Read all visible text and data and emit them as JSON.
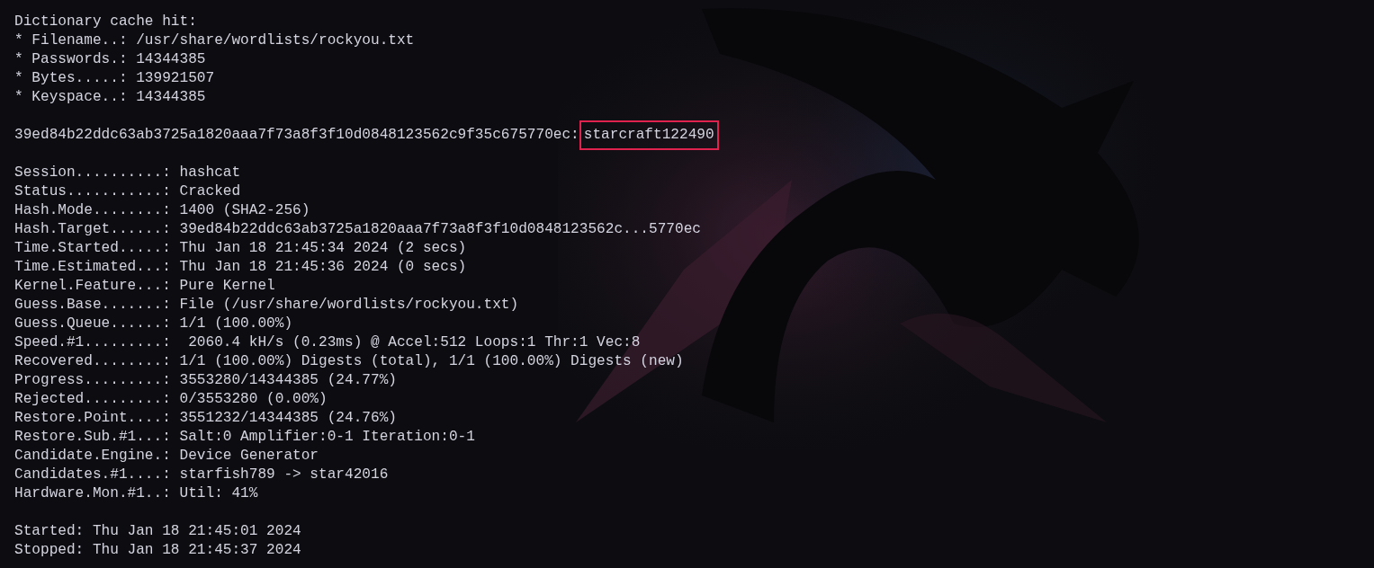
{
  "cache_info": [
    "Dictionary cache hit:",
    "* Filename..: /usr/share/wordlists/rockyou.txt",
    "* Passwords.: 14344385",
    "* Bytes.....: 139921507",
    "* Keyspace..: 14344385"
  ],
  "cracked": {
    "hash": "39ed84b22ddc63ab3725a1820aaa7f73a8f3f10d0848123562c9f35c675770ec:",
    "password": "starcraft122490",
    "highlighted": true
  },
  "status": [
    "Session..........: hashcat",
    "Status...........: Cracked",
    "Hash.Mode........: 1400 (SHA2-256)",
    "Hash.Target......: 39ed84b22ddc63ab3725a1820aaa7f73a8f3f10d0848123562c...5770ec",
    "Time.Started.....: Thu Jan 18 21:45:34 2024 (2 secs)",
    "Time.Estimated...: Thu Jan 18 21:45:36 2024 (0 secs)",
    "Kernel.Feature...: Pure Kernel",
    "Guess.Base.......: File (/usr/share/wordlists/rockyou.txt)",
    "Guess.Queue......: 1/1 (100.00%)",
    "Speed.#1.........:  2060.4 kH/s (0.23ms) @ Accel:512 Loops:1 Thr:1 Vec:8",
    "Recovered........: 1/1 (100.00%) Digests (total), 1/1 (100.00%) Digests (new)",
    "Progress.........: 3553280/14344385 (24.77%)",
    "Rejected.........: 0/3553280 (0.00%)",
    "Restore.Point....: 3551232/14344385 (24.76%)",
    "Restore.Sub.#1...: Salt:0 Amplifier:0-1 Iteration:0-1",
    "Candidate.Engine.: Device Generator",
    "Candidates.#1....: starfish789 -> star42016",
    "Hardware.Mon.#1..: Util: 41%"
  ],
  "times": [
    "Started: Thu Jan 18 21:45:01 2024",
    "Stopped: Thu Jan 18 21:45:37 2024"
  ]
}
